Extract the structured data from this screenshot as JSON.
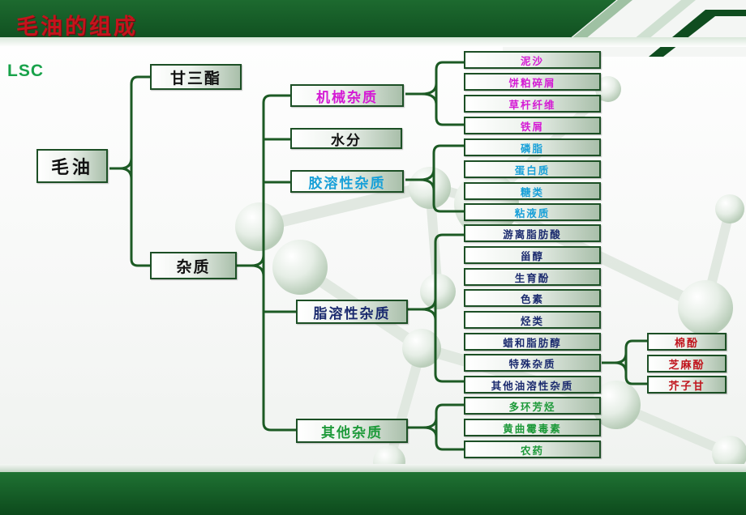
{
  "title": "毛油的组成",
  "logo": "LSC",
  "colors": {
    "header_green": "#0f4d1f",
    "title_red": "#c4141c",
    "logo_green": "#18a24a",
    "line_green": "#1c5a24",
    "magenta": "#d41ad4",
    "cyan": "#18a0d8",
    "navy": "#1a2a6e",
    "green": "#1e9a3a",
    "red": "#c0141c"
  },
  "root": "毛油",
  "level1": {
    "triglyceride": "甘三酯",
    "impurities": "杂质"
  },
  "groups": {
    "mechanical": {
      "label": "机械杂质",
      "items": [
        "泥沙",
        "饼粕碎屑",
        "草杆纤维",
        "铁屑"
      ]
    },
    "water": {
      "label": "水分"
    },
    "colloidal": {
      "label": "胶溶性杂质",
      "items": [
        "磷脂",
        "蛋白质",
        "糖类",
        "粘液质"
      ]
    },
    "lipid_soluble": {
      "label": "脂溶性杂质",
      "items": [
        "游离脂肪酸",
        "甾醇",
        "生育酚",
        "色素",
        "烃类",
        "蜡和脂肪醇",
        "特殊杂质",
        "其他油溶性杂质"
      ]
    },
    "special": {
      "items": [
        "棉酚",
        "芝麻酚",
        "芥子甘"
      ]
    },
    "other": {
      "label": "其他杂质",
      "items": [
        "多环芳烃",
        "黄曲霉毒素",
        "农药"
      ]
    }
  }
}
